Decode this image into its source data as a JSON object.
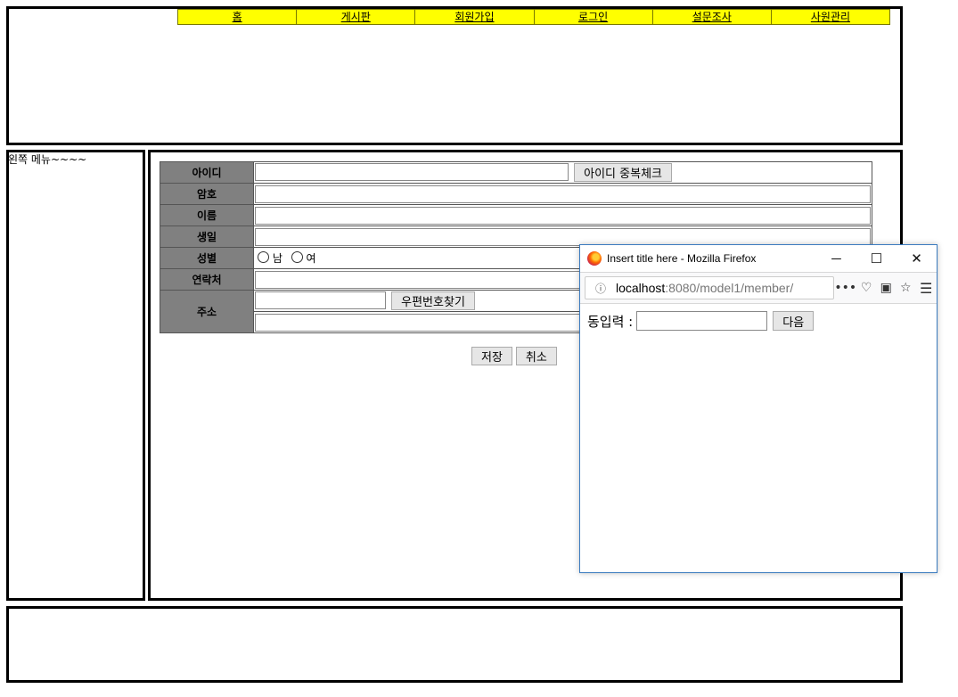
{
  "nav": [
    "홈",
    "게시판",
    "회원가입",
    "로그인",
    "설문조사",
    "사원관리"
  ],
  "left_menu": "왼쪽 메뉴~~~~",
  "form": {
    "id_label": "아이디",
    "id_check_button": "아이디 중복체크",
    "password_label": "암호",
    "name_label": "이름",
    "birth_label": "생일",
    "gender_label": "성별",
    "gender_male": "남",
    "gender_female": "여",
    "contact_label": "연락처",
    "address_label": "주소",
    "zipcode_button": "우편번호찾기",
    "save_button": "저장",
    "cancel_button": "취소"
  },
  "popup": {
    "title": "Insert title here - Mozilla Firefox",
    "url_host": "localhost",
    "url_path": ":8080/model1/member/",
    "minimize": "─",
    "maximize": "☐",
    "close": "✕",
    "dong_label": "동입력 :",
    "dong_value": "",
    "next_button": "다음"
  }
}
